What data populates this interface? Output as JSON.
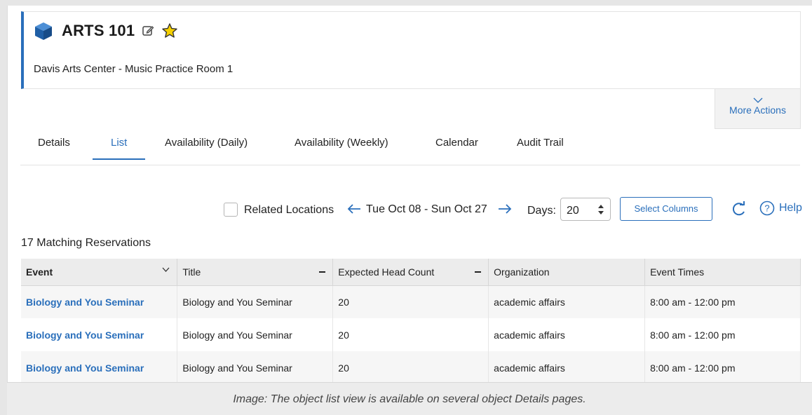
{
  "header": {
    "title": "ARTS 101",
    "subtitle": "Davis Arts Center - Music Practice Room 1"
  },
  "more_actions": {
    "label": "More Actions"
  },
  "tabs": [
    {
      "label": "Details",
      "active": false
    },
    {
      "label": "List",
      "active": true
    },
    {
      "label": "Availability (Daily)",
      "active": false
    },
    {
      "label": "Availability (Weekly)",
      "active": false
    },
    {
      "label": "Calendar",
      "active": false
    },
    {
      "label": "Audit Trail",
      "active": false
    }
  ],
  "toolbar": {
    "related_locations_label": "Related Locations",
    "related_locations_checked": false,
    "date_range": "Tue Oct 08 - Sun Oct 27",
    "days_label": "Days:",
    "days_value": "20",
    "select_columns_label": "Select Columns",
    "help_label": "Help"
  },
  "results": {
    "summary": "17 Matching Reservations"
  },
  "table": {
    "columns": [
      "Event",
      "Title",
      "Expected Head Count",
      "Organization",
      "Event Times"
    ],
    "rows": [
      [
        "Biology and You Seminar",
        "Biology and You Seminar",
        "20",
        "academic affairs",
        "8:00 am - 12:00 pm"
      ],
      [
        "Biology and You Seminar",
        "Biology and You Seminar",
        "20",
        "academic affairs",
        "8:00 am - 12:00 pm"
      ],
      [
        "Biology and You Seminar",
        "Biology and You Seminar",
        "20",
        "academic affairs",
        "8:00 am - 12:00 pm"
      ]
    ]
  },
  "caption": "Image: The object list view is available on several object Details pages.",
  "colors": {
    "accent": "#2a6fbb",
    "star": "#f5d000",
    "cube": "#1f5fa6"
  }
}
